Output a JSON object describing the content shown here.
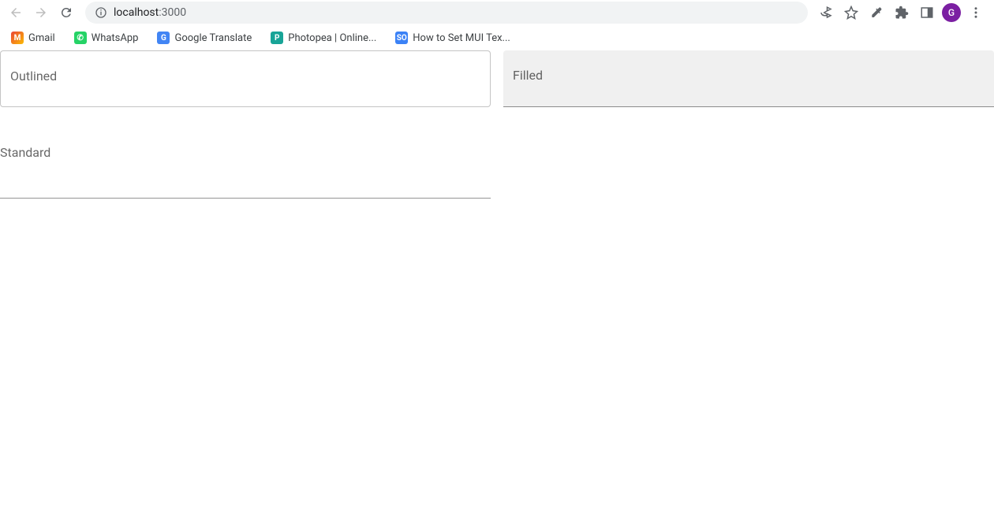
{
  "browser": {
    "url_host": "localhost",
    "url_port": ":3000"
  },
  "toolbar": {
    "avatar_letter": "G"
  },
  "bookmarks": [
    {
      "label": "Gmail"
    },
    {
      "label": "WhatsApp"
    },
    {
      "label": "Google Translate"
    },
    {
      "label": "Photopea | Online..."
    },
    {
      "label": "How to Set MUI Tex..."
    }
  ],
  "fields": {
    "outlined_label": "Outlined",
    "filled_label": "Filled",
    "standard_label": "Standard"
  }
}
